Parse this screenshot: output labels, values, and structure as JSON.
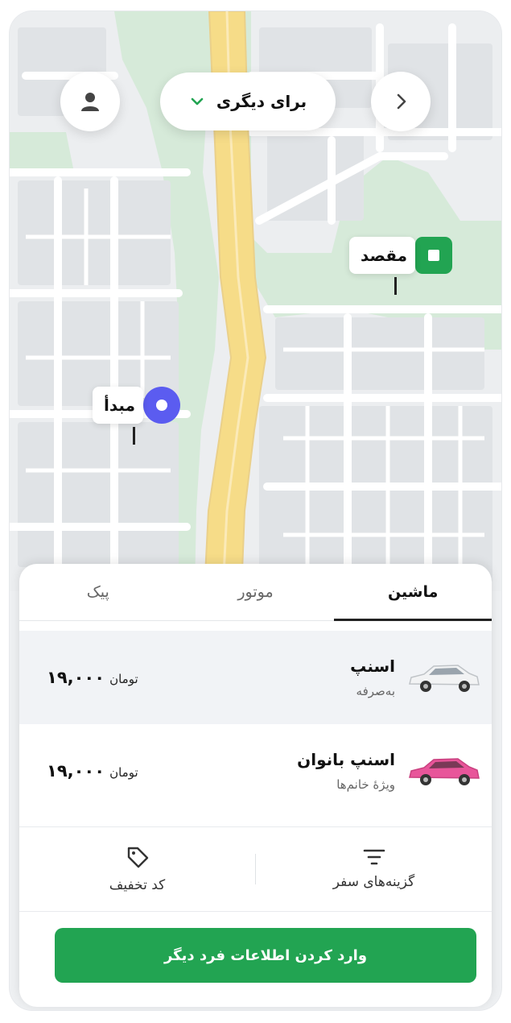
{
  "colors": {
    "accent": "#22a452",
    "origin_marker": "#5b5cf0",
    "destination_marker": "#22a452",
    "park": "#d6ead9",
    "highway": "#f6dc88"
  },
  "header": {
    "back_icon": "chevron-right-icon",
    "profile_icon": "user-icon",
    "for_other": {
      "label": "برای دیگری",
      "icon": "chevron-down-icon"
    }
  },
  "map": {
    "destination_label": "مقصد",
    "origin_label": "مبدأ"
  },
  "tabs": [
    {
      "label": "ماشین",
      "active": true
    },
    {
      "label": "موتور",
      "active": false
    },
    {
      "label": "پیک",
      "active": false
    }
  ],
  "services": [
    {
      "title": "اسنپ",
      "subtitle": "به‌صرفه",
      "price": "۱۹,۰۰۰",
      "currency": "تومان",
      "car_color": "#f2f3f4",
      "selected": true
    },
    {
      "title": "اسنپ بانوان",
      "subtitle": "ویژهٔ خانم‌ها",
      "price": "۱۹,۰۰۰",
      "currency": "تومان",
      "car_color": "#e8559a",
      "selected": false
    }
  ],
  "actions": {
    "trip_options": {
      "label": "گزینه‌های سفر",
      "icon": "filter-icon"
    },
    "discount_code": {
      "label": "کد تخفیف",
      "icon": "tag-icon"
    }
  },
  "cta_label": "وارد کردن اطلاعات فرد دیگر"
}
